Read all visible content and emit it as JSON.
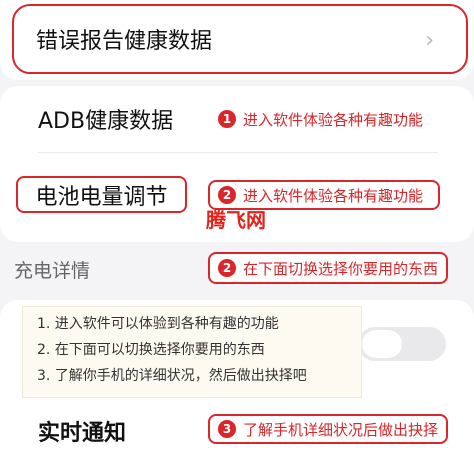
{
  "rows": {
    "error_report": "错误报告健康数据",
    "chevron": "›",
    "adb": "ADB健康数据",
    "battery": "电池电量调节",
    "realtime": "实时通知"
  },
  "section": {
    "charge_details": "充电详情"
  },
  "annotations": {
    "a1": {
      "num": "1",
      "text": "进入软件体验各种有趣功能"
    },
    "a2": {
      "num": "2",
      "text": "进入软件体验各种有趣功能"
    },
    "a3": {
      "num": "2",
      "text": "在下面切换选择你要用的东西"
    },
    "a4": {
      "num": "3",
      "text": "了解手机详细状况后做出抉择"
    }
  },
  "watermark": "腾飞网",
  "tips": [
    "1. 进入软件可以体验到各种有趣的功能",
    "2. 在下面可以切换选择你要用的东西",
    "3. 了解你手机的详细状况，然后做出抉择吧"
  ],
  "toggle": {
    "state": "off"
  },
  "colors": {
    "accent": "#d9262a",
    "background": "#f4f4f6"
  }
}
